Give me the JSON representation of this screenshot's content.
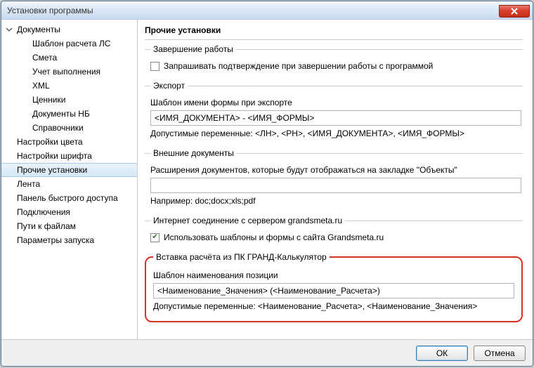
{
  "window": {
    "title": "Установки программы"
  },
  "sidebar": {
    "items": [
      {
        "label": "Документы",
        "level": "top",
        "expanded": true,
        "name": "tree-documents"
      },
      {
        "label": "Шаблон расчета ЛС",
        "level": "child",
        "name": "tree-template-ls"
      },
      {
        "label": "Смета",
        "level": "child",
        "name": "tree-smeta"
      },
      {
        "label": "Учет выполнения",
        "level": "child",
        "name": "tree-execution"
      },
      {
        "label": "XML",
        "level": "child",
        "name": "tree-xml"
      },
      {
        "label": "Ценники",
        "level": "child",
        "name": "tree-prices"
      },
      {
        "label": "Документы НБ",
        "level": "child",
        "name": "tree-documents-nb"
      },
      {
        "label": "Справочники",
        "level": "child",
        "name": "tree-references"
      },
      {
        "label": "Настройки цвета",
        "level": "top",
        "name": "tree-color-settings"
      },
      {
        "label": "Настройки шрифта",
        "level": "top",
        "name": "tree-font-settings"
      },
      {
        "label": "Прочие установки",
        "level": "top",
        "selected": true,
        "name": "tree-other-settings"
      },
      {
        "label": "Лента",
        "level": "top",
        "name": "tree-ribbon"
      },
      {
        "label": "Панель быстрого доступа",
        "level": "top",
        "name": "tree-quick-access"
      },
      {
        "label": "Подключения",
        "level": "top",
        "name": "tree-connections"
      },
      {
        "label": "Пути к файлам",
        "level": "top",
        "name": "tree-file-paths"
      },
      {
        "label": "Параметры запуска",
        "level": "top",
        "name": "tree-startup-params"
      }
    ]
  },
  "content": {
    "title": "Прочие установки",
    "shutdown": {
      "legend": "Завершение работы",
      "confirm_label": "Запрашивать подтверждение при завершении работы с программой",
      "confirm_checked": false
    },
    "export": {
      "legend": "Экспорт",
      "template_label": "Шаблон имени формы при экспорте",
      "template_value": "<ИМЯ_ДОКУМЕНТА> - <ИМЯ_ФОРМЫ>",
      "vars_label": "Допустимые переменные: <ЛН>, <РН>, <ИМЯ_ДОКУМЕНТА>, <ИМЯ_ФОРМЫ>"
    },
    "external_docs": {
      "legend": "Внешние документы",
      "ext_label": "Расширения документов, которые будут отображаться на закладке \"Объекты\"",
      "ext_value": "",
      "example_label": "Например: doc;docx;xls;pdf"
    },
    "internet": {
      "legend": "Интернет соединение с сервером grandsmeta.ru",
      "use_templates_label": "Использовать шаблоны и формы с сайта Grandsmeta.ru",
      "use_templates_checked": true
    },
    "calc_insert": {
      "legend": "Вставка расчёта из ПК ГРАНД-Калькулятор",
      "template_label": "Шаблон наименования позиции",
      "template_value": "<Наименование_Значения> (<Наименование_Расчета>)",
      "vars_label": "Допустимые переменные: <Наименование_Расчета>, <Наименование_Значения>"
    }
  },
  "footer": {
    "ok_label": "ОК",
    "cancel_label": "Отмена"
  }
}
